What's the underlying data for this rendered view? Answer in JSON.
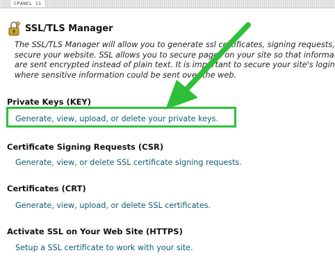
{
  "topbar": {
    "label": "CPANEL 11"
  },
  "header": {
    "title": "SSL/TLS Manager",
    "icon": "lock-keys-icon"
  },
  "description": {
    "lines": [
      "The SSL/TLS Manager will allow you to generate ssl certificates, signing requests, a",
      "secure your website. SSL allows you to secure pages on your site so that informati",
      "are sent encrypted instead of plain text. It is important to secure your site's login a",
      "where sensitive information could be sent over the web."
    ]
  },
  "sections": [
    {
      "heading": "Private Keys (KEY)",
      "link": "Generate, view, upload, or delete your private keys."
    },
    {
      "heading": "Certificate Signing Requests (CSR)",
      "link": "Generate, view, or delete SSL certificate signing requests."
    },
    {
      "heading": "Certificates (CRT)",
      "link": "Generate, view, upload, or delete SSL certificates."
    },
    {
      "heading": "Activate SSL on Your Web Site (HTTPS)",
      "link": "Setup a SSL certificate to work with your site."
    }
  ],
  "annotation": {
    "color": "#2fbf3a"
  },
  "colors": {
    "link": "#0b5d6e"
  }
}
